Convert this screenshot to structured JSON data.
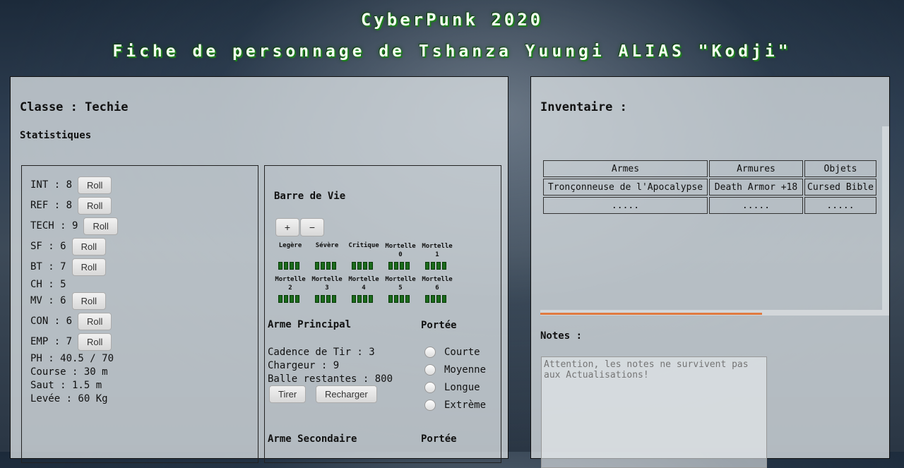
{
  "header": {
    "title": "CyberPunk 2020",
    "subtitle": "Fiche de personnage de Tshanza Yuungi ALIAS \"Kodji\""
  },
  "character": {
    "class_label": "Classe : Techie",
    "stats_heading": "Statistiques",
    "roll_label": "Roll",
    "stats": [
      {
        "label": "INT : 8"
      },
      {
        "label": "REF : 8"
      },
      {
        "label": "TECH : 9"
      },
      {
        "label": "SF : 6"
      },
      {
        "label": "BT : 7"
      },
      {
        "label": "CH : 5"
      },
      {
        "label": "MV : 6"
      },
      {
        "label": "CON : 6"
      },
      {
        "label": "EMP : 7"
      }
    ],
    "derived": {
      "ph": "PH : 40.5 / 70",
      "course": "Course : 30 m",
      "saut": "Saut : 1.5 m",
      "levee": "Levée : 60 Kg"
    }
  },
  "health": {
    "heading": "Barre de Vie",
    "plus": "+",
    "minus": "−",
    "levels": [
      {
        "l1": "Legère",
        "l2": ""
      },
      {
        "l1": "Sévère",
        "l2": ""
      },
      {
        "l1": "Critique",
        "l2": ""
      },
      {
        "l1": "Mortelle",
        "l2": "0"
      },
      {
        "l1": "Mortelle",
        "l2": "1"
      },
      {
        "l1": "Mortelle",
        "l2": "2"
      },
      {
        "l1": "Mortelle",
        "l2": "3"
      },
      {
        "l1": "Mortelle",
        "l2": "4"
      },
      {
        "l1": "Mortelle",
        "l2": "5"
      },
      {
        "l1": "Mortelle",
        "l2": "6"
      }
    ]
  },
  "weapon_primary": {
    "heading": "Arme Principal",
    "range_heading": "Portée",
    "cadence": "Cadence de Tir : 3",
    "chargeur": "Chargeur : 9",
    "balles": "Balle restantes : 800",
    "fire_label": "Tirer",
    "reload_label": "Recharger",
    "ranges": [
      "Courte",
      "Moyenne",
      "Longue",
      "Extrème"
    ]
  },
  "weapon_secondary": {
    "heading": "Arme Secondaire",
    "range_heading": "Portée"
  },
  "inventory": {
    "heading": "Inventaire :",
    "columns": [
      "Armes",
      "Armures",
      "Objets"
    ],
    "rows": [
      [
        "Tronçonneuse de l'Apocalypse",
        "Death Armor +18",
        "Cursed Bible"
      ],
      [
        ".....",
        ".....",
        "....."
      ]
    ]
  },
  "notes": {
    "heading": "Notes :",
    "placeholder": "Attention, les notes ne survivent pas aux Actualisations!"
  },
  "colors": {
    "accent_orange": "#e07a40",
    "health_green": "#1b6b1b",
    "title_glow": "#1d7d1d"
  }
}
